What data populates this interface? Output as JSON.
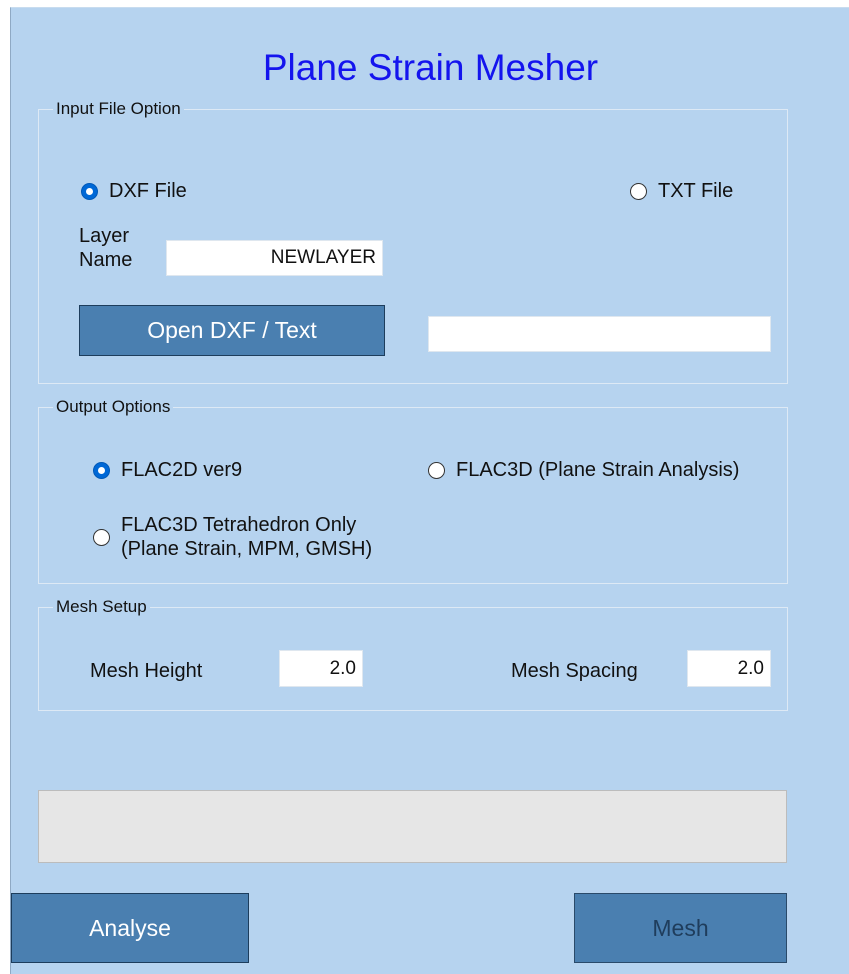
{
  "title": "Plane Strain Mesher",
  "input_group": {
    "legend": "Input File Option",
    "dxf_label": "DXF File",
    "dxf_checked": true,
    "txt_label": "TXT File",
    "txt_checked": false,
    "layer_label_line1": "Layer",
    "layer_label_line2": "Name",
    "layer_value": "NEWLAYER",
    "open_button_label": "Open DXF / Text",
    "file_path_value": ""
  },
  "output_group": {
    "legend": "Output Options",
    "flac2d_label": "FLAC2D ver9",
    "flac2d_checked": true,
    "flac3d_label": "FLAC3D (Plane Strain Analysis)",
    "flac3d_checked": false,
    "tetra_label_line1": "FLAC3D Tetrahedron Only",
    "tetra_label_line2": "(Plane Strain, MPM, GMSH)",
    "tetra_checked": false
  },
  "mesh_group": {
    "legend": "Mesh Setup",
    "height_label": "Mesh Height",
    "height_value": "2.0",
    "spacing_label": "Mesh Spacing",
    "spacing_value": "2.0"
  },
  "progress": {
    "value": 0
  },
  "buttons": {
    "analyse_label": "Analyse",
    "mesh_label": "Mesh",
    "mesh_enabled": false
  },
  "colors": {
    "background": "#b6d3ef",
    "title": "#1414ee",
    "button": "#4a7fb0",
    "radio_checked": "#0068d6"
  }
}
